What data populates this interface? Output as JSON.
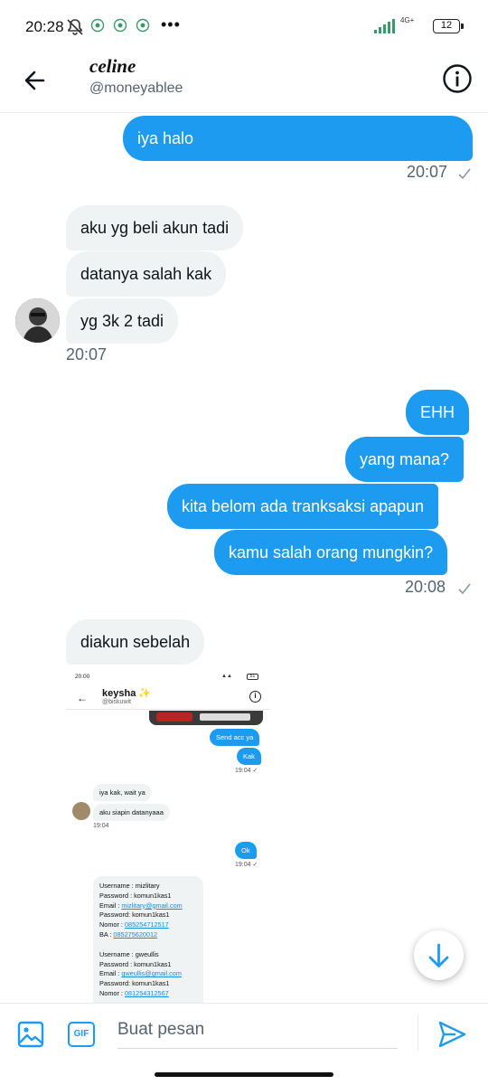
{
  "status_bar": {
    "time": "20:28",
    "more": "•••",
    "network": "4G+",
    "battery": "12"
  },
  "header": {
    "name": "celine",
    "handle": "@moneyablee"
  },
  "messages": {
    "m1": "iya halo",
    "t1": "20:07",
    "m2": "aku yg beli akun tadi",
    "m3": "datanya salah kak",
    "m4": "yg 3k 2 tadi",
    "t2": "20:07",
    "m5": "EHH",
    "m6": "yang mana?",
    "m7": "kita belom ada tranksaksi apapun",
    "m8": "kamu salah orang mungkin?",
    "t3": "20:08",
    "m9": "diakun sebelah"
  },
  "embedded": {
    "status_time": "20:00",
    "battery": "51",
    "name": "keysha",
    "star": "✨",
    "handle": "@biskuwit",
    "b1": "Send acc ya",
    "b2": "Kak",
    "t1": "19:04 ✓",
    "b3": "iya kak, wait ya",
    "b4": "aku siapin datanyaaa",
    "t2": "19:04",
    "b5": "Ok",
    "t3": "19:04 ✓",
    "card": {
      "a_user": "Username : mizlitary",
      "a_pass": "Password  : komun1kas1",
      "a_email_label": "Email : ",
      "a_email": "mizlitary@gmail.com",
      "a_pass2": "Password: komun1kas1",
      "a_nomor_label": "Nomor : ",
      "a_nomor": "085254712517",
      "a_ba_label": "BA : ",
      "a_ba": "085275620012",
      "b_user": "Username :  gweullis",
      "b_pass": "Password  : komun1kas1",
      "b_email_label": "Email : ",
      "b_email": "gweullis@gmail.com",
      "b_pass2": "Password: komun1kas1",
      "b_nomor_label": "Nomor : ",
      "b_nomor": "081254312567"
    }
  },
  "composer": {
    "gif_label": "GIF",
    "placeholder": "Buat pesan"
  },
  "colors": {
    "accent": "#1d9bf0",
    "incoming_bubble": "#eff3f4",
    "secondary_text": "#536471"
  }
}
